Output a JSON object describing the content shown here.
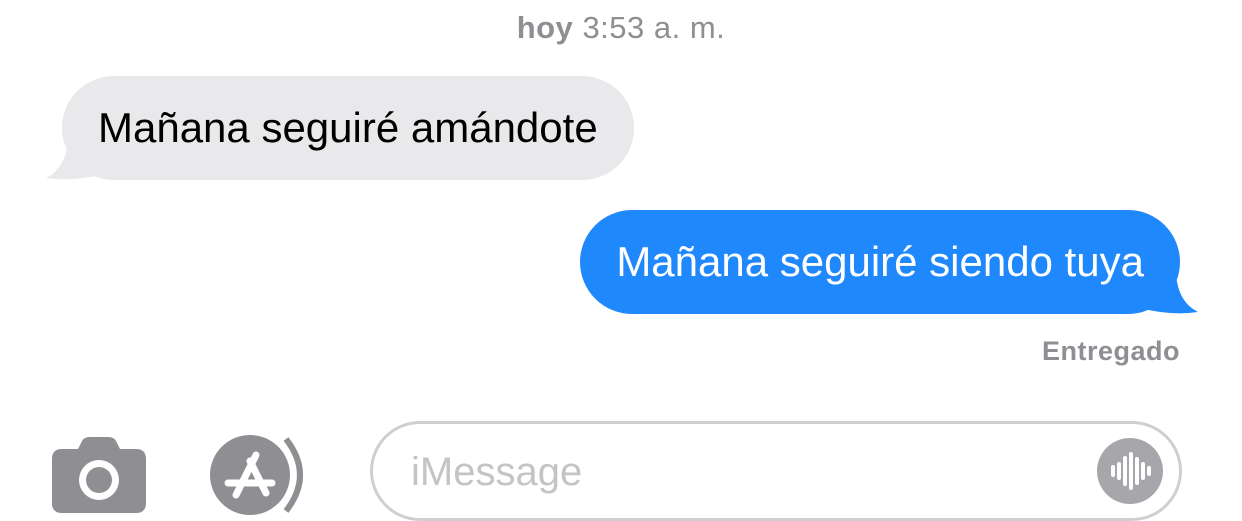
{
  "timestamp": {
    "day": "hoy",
    "time": "3:53 a. m."
  },
  "messages": [
    {
      "direction": "incoming",
      "text": "Mañana seguiré amándote"
    },
    {
      "direction": "outgoing",
      "text": "Mañana seguiré siendo tuya"
    }
  ],
  "status": {
    "delivered_label": "Entregado"
  },
  "toolbar": {
    "camera_icon": "camera-icon",
    "apps_icon": "app-store-icon",
    "input_placeholder": "iMessage",
    "audio_icon": "audio-waveform-icon"
  },
  "colors": {
    "incoming_bubble": "#e9e9eb",
    "outgoing_bubble": "#1e88fc",
    "secondary_text": "#8e8e93"
  }
}
